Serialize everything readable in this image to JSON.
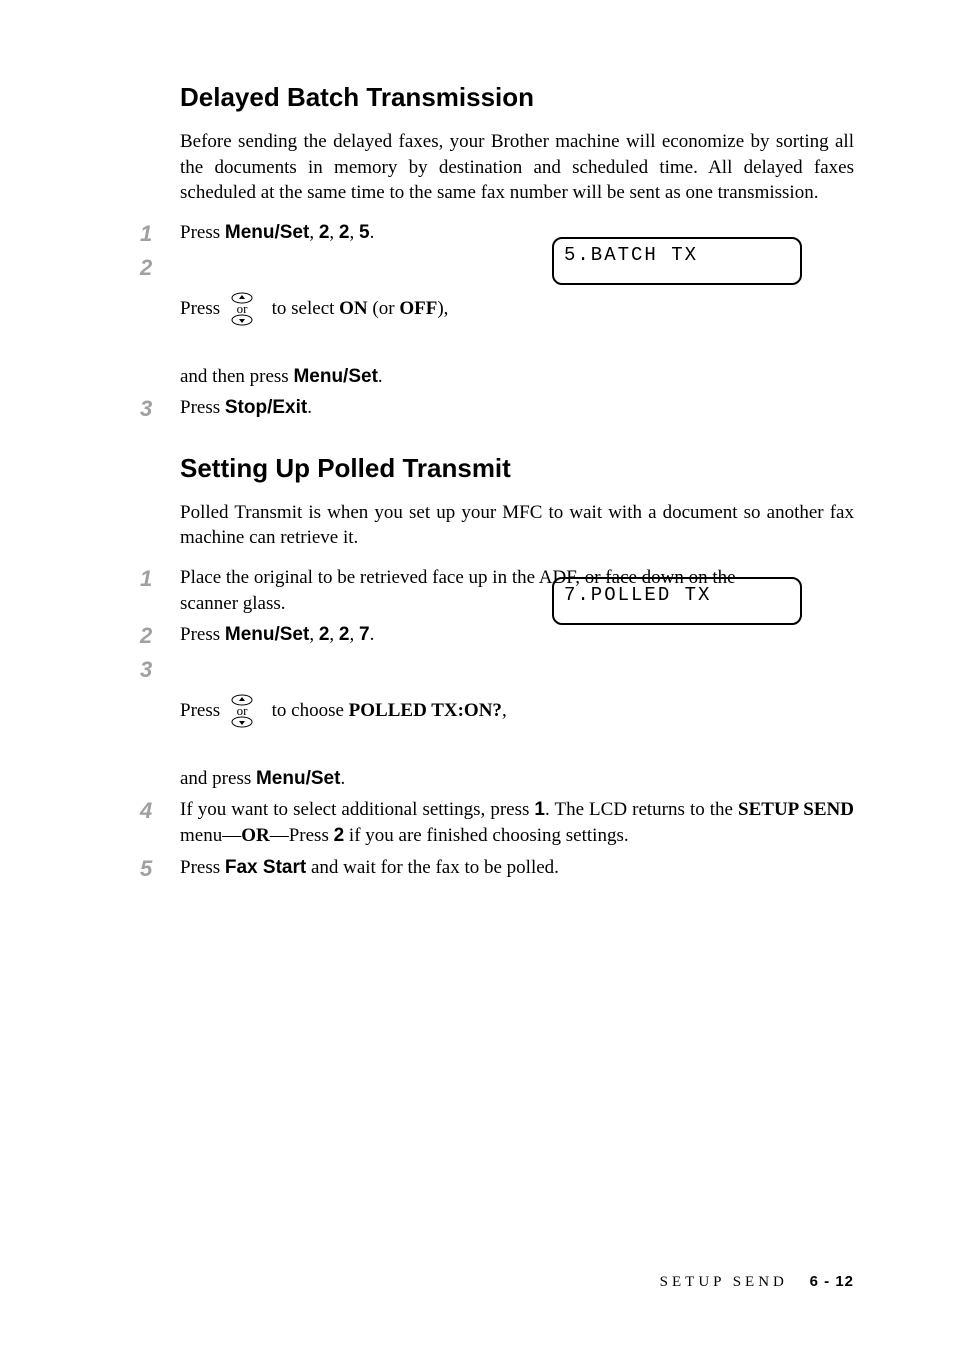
{
  "section1": {
    "heading": "Delayed Batch Transmission",
    "intro": "Before sending the delayed faxes, your Brother machine will economize by sorting all the documents in memory by destination and scheduled time. All delayed faxes scheduled at the same time to the same fax number will be sent as one transmission.",
    "steps": {
      "s1": {
        "n": "1",
        "a": "Press ",
        "b": "Menu/Set",
        "c": ", ",
        "d": "2",
        "e": ", ",
        "f": "2",
        "g": ", ",
        "h": "5",
        "i": "."
      },
      "s2": {
        "n": "2",
        "a": "Press ",
        "b": " to select ",
        "on": "ON",
        "c": " (or ",
        "off": "OFF",
        "d": "),",
        "e": "and then press ",
        "f": "Menu/Set",
        "g": "."
      },
      "s3": {
        "n": "3",
        "a": "Press ",
        "b": "Stop/Exit",
        "c": "."
      }
    },
    "lcd": "5.BATCH TX"
  },
  "section2": {
    "heading": "Setting Up Polled Transmit",
    "intro": "Polled Transmit is when you set up your MFC to wait with a document so another fax machine can retrieve it.",
    "steps": {
      "s1": {
        "n": "1",
        "a": "Place the original to be retrieved face up in the ADF, or face down on the scanner glass."
      },
      "s2": {
        "n": "2",
        "a": "Press ",
        "b": "Menu/Set",
        "c": ", ",
        "d": "2",
        "e": ", ",
        "f": "2",
        "g": ", ",
        "h": "7",
        "i": "."
      },
      "s3": {
        "n": "3",
        "a": "Press ",
        "b": " to choose ",
        "c": "POLLED TX:ON?",
        "d": ",",
        "e": "and press ",
        "f": "Menu/Set",
        "g": "."
      },
      "s4": {
        "n": "4",
        "a": "If you want to select additional settings, press ",
        "b": "1",
        "c": ". The LCD returns to the ",
        "d": "SETUP SEND",
        "e": " menu—",
        "f": "OR",
        "g": "—Press ",
        "h": "2",
        "i": " if you are finished choosing settings."
      },
      "s5": {
        "n": "5",
        "a": "Press ",
        "b": "Fax Start",
        "c": " and wait for the fax to be polled."
      }
    },
    "lcd": "7.POLLED TX"
  },
  "footer": {
    "chapter": "SETUP SEND",
    "page": "6 - 12"
  },
  "icon_label": "or"
}
